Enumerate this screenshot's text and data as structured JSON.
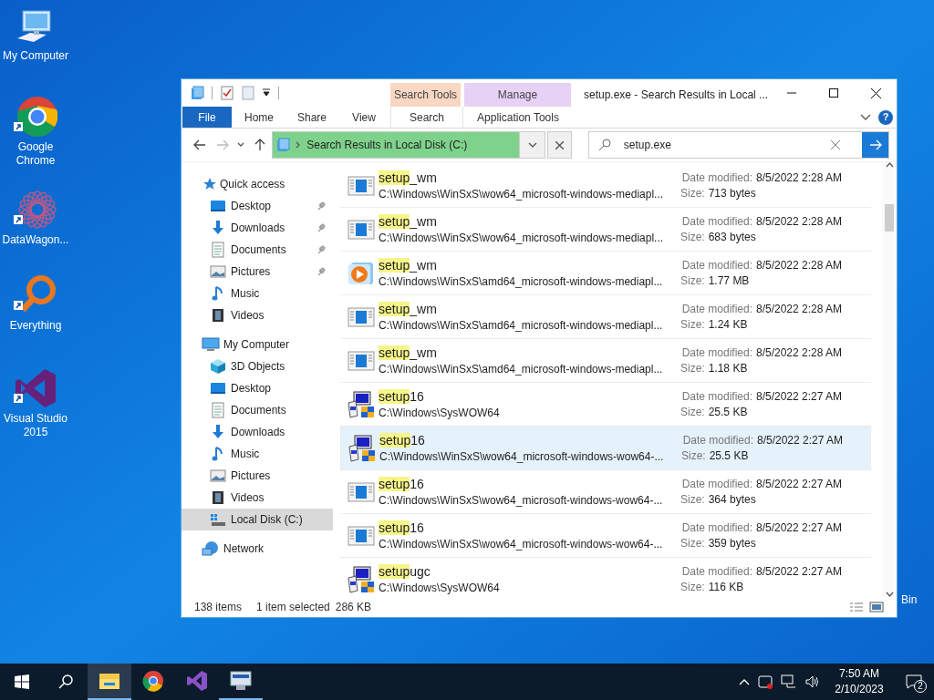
{
  "desktop_icons": [
    {
      "label": "My Computer",
      "kind": "computer"
    },
    {
      "label": "Google Chrome",
      "kind": "chrome"
    },
    {
      "label": "DataWagon...",
      "kind": "flower"
    },
    {
      "label": "Everything",
      "kind": "loupe"
    },
    {
      "label": "Visual Studio 2015",
      "kind": "vs"
    }
  ],
  "desktop_partial_label": "Bin",
  "window": {
    "title": "setup.exe - Search Results in Local ..."
  },
  "ribbon": {
    "tabs": [
      {
        "label": "File",
        "kind": "file"
      },
      {
        "label": "Home",
        "kind": "tab"
      },
      {
        "label": "Share",
        "kind": "tab"
      },
      {
        "label": "View",
        "kind": "tab"
      }
    ],
    "contextual": [
      {
        "label": "Search Tools",
        "color": "#f9d7c3",
        "tabs": [
          "Search"
        ]
      },
      {
        "label": "Manage",
        "color": "#e7d2f6",
        "tabs": [
          "Application Tools"
        ]
      }
    ]
  },
  "help": "?",
  "address": {
    "breadcrumb": "Search Results in Local Disk (C:)"
  },
  "search": {
    "value": "setup.exe"
  },
  "nav_pane": [
    {
      "label": "Quick access",
      "kind": "star",
      "children": [
        {
          "label": "Desktop",
          "kind": "desktop",
          "pinned": true,
          "selected": false
        },
        {
          "label": "Downloads",
          "kind": "downloads",
          "pinned": true,
          "selected": false
        },
        {
          "label": "Documents",
          "kind": "documents",
          "pinned": true,
          "selected": false
        },
        {
          "label": "Pictures",
          "kind": "pictures",
          "pinned": true,
          "selected": false
        },
        {
          "label": "Music",
          "kind": "music",
          "pinned": false,
          "selected": false
        },
        {
          "label": "Videos",
          "kind": "videos",
          "pinned": false,
          "selected": false
        }
      ]
    },
    {
      "label": "My Computer",
      "kind": "computer",
      "children": [
        {
          "label": "3D Objects",
          "kind": "objects",
          "pinned": false,
          "selected": false
        },
        {
          "label": "Desktop",
          "kind": "desktop",
          "pinned": false,
          "selected": false
        },
        {
          "label": "Documents",
          "kind": "documents",
          "pinned": false,
          "selected": false
        },
        {
          "label": "Downloads",
          "kind": "downloads",
          "pinned": false,
          "selected": false
        },
        {
          "label": "Music",
          "kind": "music",
          "pinned": false,
          "selected": false
        },
        {
          "label": "Pictures",
          "kind": "pictures",
          "pinned": false,
          "selected": false
        },
        {
          "label": "Videos",
          "kind": "videos",
          "pinned": false,
          "selected": false
        },
        {
          "label": "Local Disk (C:)",
          "kind": "drive",
          "pinned": false,
          "selected": true
        }
      ]
    },
    {
      "label": "Network",
      "kind": "network"
    }
  ],
  "results": [
    {
      "match": "setup",
      "rest": "_wm",
      "path": "C:\\Windows\\WinSxS\\wow64_microsoft-windows-mediapl...",
      "date_label": "Date modified:",
      "date": "8/5/2022 2:28 AM",
      "size_label": "Size:",
      "size": "713 bytes",
      "kind": "document",
      "selected": false
    },
    {
      "match": "setup",
      "rest": "_wm",
      "path": "C:\\Windows\\WinSxS\\wow64_microsoft-windows-mediapl...",
      "date_label": "Date modified:",
      "date": "8/5/2022 2:28 AM",
      "size_label": "Size:",
      "size": "683 bytes",
      "kind": "document",
      "selected": false
    },
    {
      "match": "setup",
      "rest": "_wm",
      "path": "C:\\Windows\\WinSxS\\amd64_microsoft-windows-mediapl...",
      "date_label": "Date modified:",
      "date": "8/5/2022 2:28 AM",
      "size_label": "Size:",
      "size": "1.77 MB",
      "kind": "media",
      "selected": false
    },
    {
      "match": "setup",
      "rest": "_wm",
      "path": "C:\\Windows\\WinSxS\\amd64_microsoft-windows-mediapl...",
      "date_label": "Date modified:",
      "date": "8/5/2022 2:28 AM",
      "size_label": "Size:",
      "size": "1.24 KB",
      "kind": "document",
      "selected": false
    },
    {
      "match": "setup",
      "rest": "_wm",
      "path": "C:\\Windows\\WinSxS\\amd64_microsoft-windows-mediapl...",
      "date_label": "Date modified:",
      "date": "8/5/2022 2:28 AM",
      "size_label": "Size:",
      "size": "1.18 KB",
      "kind": "document",
      "selected": false
    },
    {
      "match": "setup",
      "rest": "16",
      "path": "C:\\Windows\\SysWOW64",
      "date_label": "Date modified:",
      "date": "8/5/2022 2:27 AM",
      "size_label": "Size:",
      "size": "25.5 KB",
      "kind": "installer",
      "selected": false
    },
    {
      "match": "setup",
      "rest": "16",
      "path": "C:\\Windows\\WinSxS\\wow64_microsoft-windows-wow64-...",
      "date_label": "Date modified:",
      "date": "8/5/2022 2:27 AM",
      "size_label": "Size:",
      "size": "25.5 KB",
      "kind": "installer",
      "selected": true
    },
    {
      "match": "setup",
      "rest": "16",
      "path": "C:\\Windows\\WinSxS\\wow64_microsoft-windows-wow64-...",
      "date_label": "Date modified:",
      "date": "8/5/2022 2:27 AM",
      "size_label": "Size:",
      "size": "364 bytes",
      "kind": "document",
      "selected": false
    },
    {
      "match": "setup",
      "rest": "16",
      "path": "C:\\Windows\\WinSxS\\wow64_microsoft-windows-wow64-...",
      "date_label": "Date modified:",
      "date": "8/5/2022 2:27 AM",
      "size_label": "Size:",
      "size": "359 bytes",
      "kind": "document",
      "selected": false
    },
    {
      "match": "setup",
      "rest": "ugc",
      "path": "C:\\Windows\\SysWOW64",
      "date_label": "Date modified:",
      "date": "8/5/2022 2:27 AM",
      "size_label": "Size:",
      "size": "116 KB",
      "kind": "installer",
      "selected": false
    }
  ],
  "status_bar": {
    "count": "138 items",
    "selection": "1 item selected",
    "size": "286 KB"
  },
  "taskbar": {
    "apps": [
      {
        "kind": "explorer",
        "active": true
      },
      {
        "kind": "chrome",
        "active": false
      },
      {
        "kind": "vs",
        "active": false
      },
      {
        "kind": "netapp",
        "active": false
      }
    ],
    "time": "7:50 AM",
    "date": "2/10/2023",
    "notifications": "2"
  }
}
